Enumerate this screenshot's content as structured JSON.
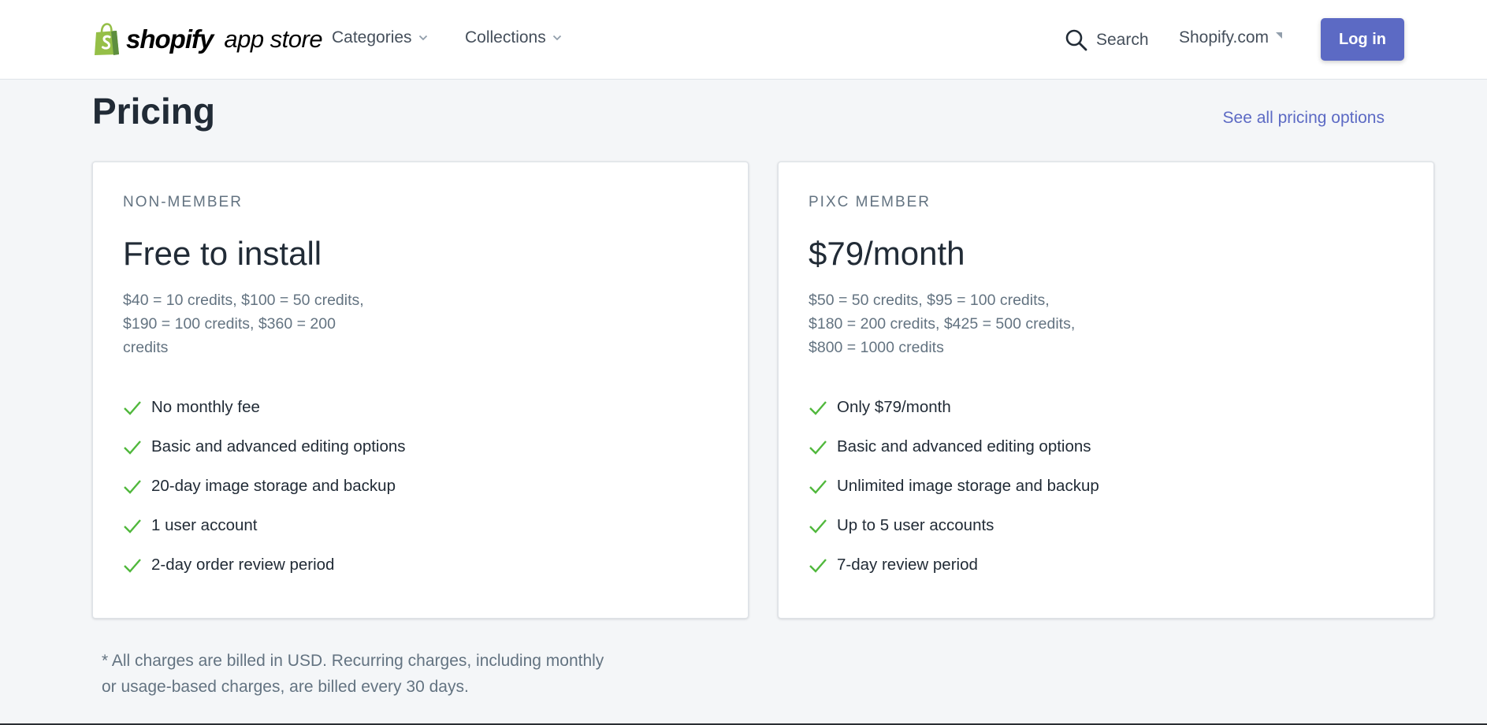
{
  "header": {
    "logo": {
      "brand": "shopify",
      "suffix": "app store",
      "icon": "shopping-bag-icon",
      "brand_color": "#95bf47"
    },
    "nav": [
      {
        "label": "Categories",
        "icon": "chevron-down-icon"
      },
      {
        "label": "Collections",
        "icon": "chevron-down-icon"
      }
    ],
    "search_label": "Search",
    "external_link_label": "Shopify.com",
    "login_label": "Log in",
    "accent_color": "#5c6ac4"
  },
  "pricing": {
    "title": "Pricing",
    "see_all_label": "See all pricing options",
    "plans": [
      {
        "tier": "NON-MEMBER",
        "price": "Free to install",
        "description": "$40 = 10 credits, $100 = 50 credits, $190 = 100 credits, $360 = 200 credits",
        "features": [
          "No monthly fee",
          "Basic and advanced editing options",
          "20-day image storage and backup",
          "1 user account",
          "2-day order review period"
        ]
      },
      {
        "tier": "PIXC MEMBER",
        "price": "$79/month",
        "description": "$50 = 50 credits, $95 = 100 credits, $180 = 200 credits, $425 = 500 credits, $800 = 1000 credits",
        "features": [
          "Only $79/month",
          "Basic and advanced editing options",
          "Unlimited image storage and backup",
          "Up to 5 user accounts",
          "7-day review period"
        ]
      }
    ],
    "check_icon": "checkmark-icon",
    "check_color": "#50b83c",
    "footnote": "* All charges are billed in USD. Recurring charges, including monthly or usage-based charges, are billed every 30 days."
  }
}
